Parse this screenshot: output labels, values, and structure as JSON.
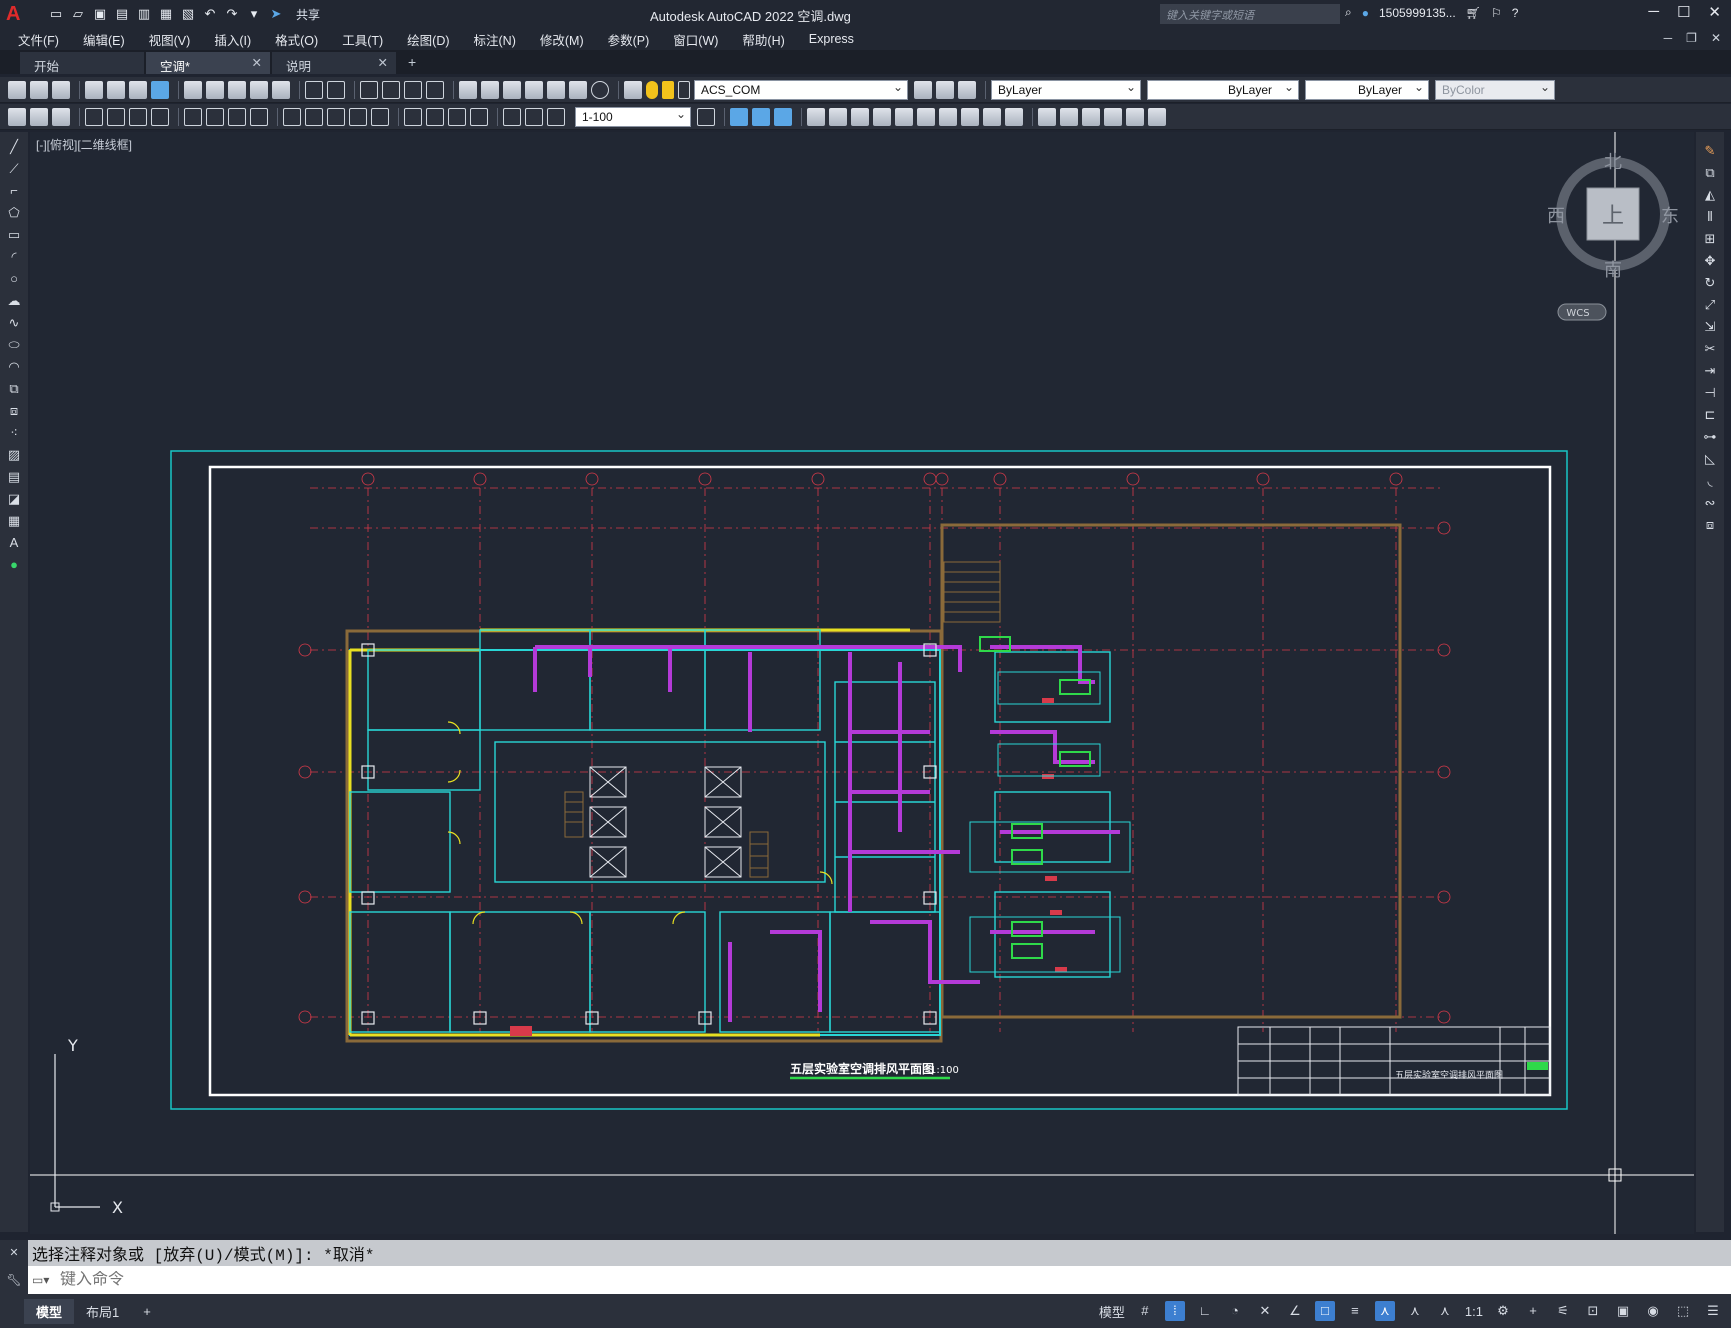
{
  "app": {
    "title": "Autodesk AutoCAD 2022    空调.dwg",
    "share_label": "共享",
    "search_placeholder": "键入关键字或短语",
    "user": "1505999135..."
  },
  "menu": [
    "文件(F)",
    "编辑(E)",
    "视图(V)",
    "插入(I)",
    "格式(O)",
    "工具(T)",
    "绘图(D)",
    "标注(N)",
    "修改(M)",
    "参数(P)",
    "窗口(W)",
    "帮助(H)",
    "Express"
  ],
  "tabs": [
    {
      "label": "开始",
      "active": false
    },
    {
      "label": "空调*",
      "active": true
    },
    {
      "label": "说明",
      "active": false
    }
  ],
  "toolbar": {
    "layer_combo": "ACS_COM",
    "color_combo": "ByLayer",
    "linetype_combo": "ByLayer",
    "lineweight_combo": "ByLayer",
    "plotstyle_combo": "ByColor",
    "scale_combo": "1-100"
  },
  "viewport": {
    "label": "[-][俯视][二维线框]",
    "viewcube": {
      "north": "北",
      "south": "南",
      "east": "东",
      "west": "西",
      "face": "上",
      "wcs": "WCS"
    },
    "ucs": {
      "x": "X",
      "y": "Y"
    }
  },
  "drawing": {
    "title": "五层实验室空调排风平面图",
    "scale": "1:100",
    "titleblock_name": "五层实验室空调排风平面图"
  },
  "command": {
    "history": "选择注释对象或 [放弃(U)/模式(M)]: *取消*",
    "placeholder": "键入命令"
  },
  "status": {
    "layout_tabs": [
      "模型",
      "布局1"
    ],
    "model_label": "模型",
    "scale": "1:1"
  },
  "colors": {
    "accent": "#3d7fd0",
    "canvas_bg": "#212733",
    "frame_cyan": "#19c6c6",
    "duct_magenta": "#b43ad8",
    "wall_cyan": "#29d6d6",
    "axis_red": "#d83a4a",
    "yellow": "#e8e021",
    "brown": "#8a6a3a",
    "green": "#2fd94a"
  }
}
